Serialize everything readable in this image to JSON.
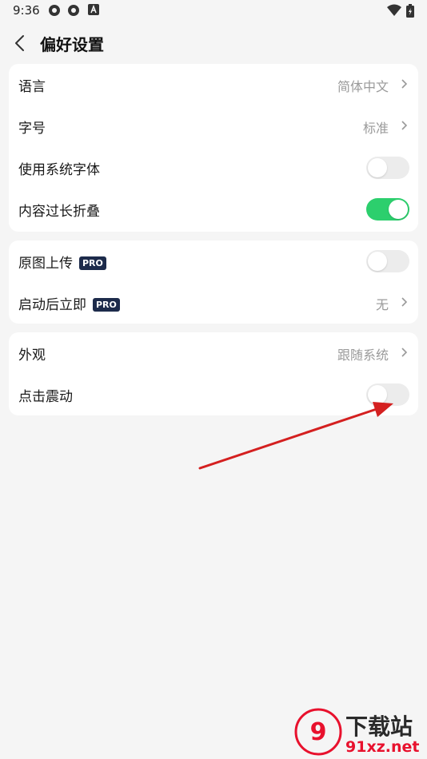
{
  "status_bar": {
    "time": "9:36"
  },
  "header": {
    "title": "偏好设置"
  },
  "group1": {
    "language": {
      "label": "语言",
      "value": "简体中文"
    },
    "font_size": {
      "label": "字号",
      "value": "标准"
    },
    "system_font": {
      "label": "使用系统字体",
      "enabled": false
    },
    "collapse_long": {
      "label": "内容过长折叠",
      "enabled": true
    }
  },
  "group2": {
    "original_upload": {
      "label": "原图上传",
      "badge": "PRO",
      "enabled": false
    },
    "launch_immediately": {
      "label": "启动后立即",
      "badge": "PRO",
      "value": "无"
    }
  },
  "group3": {
    "appearance": {
      "label": "外观",
      "value": "跟随系统"
    },
    "click_vibration": {
      "label": "点击震动",
      "enabled": false
    }
  },
  "colors": {
    "toggle_on": "#2ccf6d",
    "badge_bg": "#1d2b4b",
    "annotation_arrow": "#d42020"
  },
  "watermark": {
    "top_text": "下载站",
    "bottom_text": "91xz.net"
  }
}
